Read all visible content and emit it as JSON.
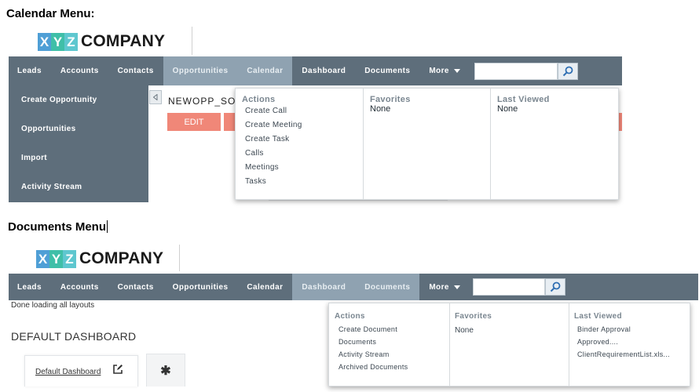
{
  "section1": {
    "heading": "Calendar Menu:",
    "logo": {
      "letters": [
        "X",
        "Y",
        "Z"
      ],
      "word": "COMPANY"
    },
    "nav": [
      {
        "label": "Leads"
      },
      {
        "label": "Accounts"
      },
      {
        "label": "Contacts"
      },
      {
        "label": "Opportunities"
      },
      {
        "label": "Calendar"
      },
      {
        "label": "Dashboard"
      },
      {
        "label": "Documents"
      },
      {
        "label": "More"
      }
    ],
    "submenu": [
      "Create Opportunity",
      "Opportunities",
      "Import",
      "Activity Stream"
    ],
    "record_title": "NEWOPP_SO",
    "edit_label": "EDIT",
    "dropdown": {
      "actions_heading": "Actions",
      "actions": [
        "Create Call",
        "Create Meeting",
        "Create Task",
        "Calls",
        "Meetings",
        "Tasks"
      ],
      "favorites_heading": "Favorites",
      "favorites_value": "None",
      "last_viewed_heading": "Last Viewed",
      "last_viewed_value": "None"
    }
  },
  "section2": {
    "heading": "Documents Menu",
    "logo": {
      "letters": [
        "X",
        "Y",
        "Z"
      ],
      "word": "COMPANY"
    },
    "nav": [
      {
        "label": "Leads"
      },
      {
        "label": "Accounts"
      },
      {
        "label": "Contacts"
      },
      {
        "label": "Opportunities"
      },
      {
        "label": "Calendar"
      },
      {
        "label": "Dashboard"
      },
      {
        "label": "Documents"
      },
      {
        "label": "More"
      }
    ],
    "status_text": "Done loading all layouts",
    "page_title": "DEFAULT DASHBOARD",
    "tab_label": "Default Dashboard",
    "dropdown": {
      "actions_heading": "Actions",
      "actions": [
        "Create Document",
        "Documents",
        "Activity Stream",
        "Archived Documents"
      ],
      "favorites_heading": "Favorites",
      "favorites_value": "None",
      "last_viewed_heading": "Last Viewed",
      "last_viewed": [
        "Binder Approval",
        "Approved....",
        "ClientRequirementList.xls..."
      ]
    }
  },
  "colors": {
    "nav_bg": "#5e6e7b",
    "nav_active": "#8fa2b1",
    "logo_x": "#4f9fd6",
    "logo_y": "#3fbfa8",
    "logo_z": "#5ec7cf",
    "edit_button": "#f08778"
  },
  "icons": {
    "search": "magnifier-icon",
    "collapse": "triangle-left-icon",
    "edit": "pencil-square-icon",
    "tab_add": "asterisk-icon"
  }
}
